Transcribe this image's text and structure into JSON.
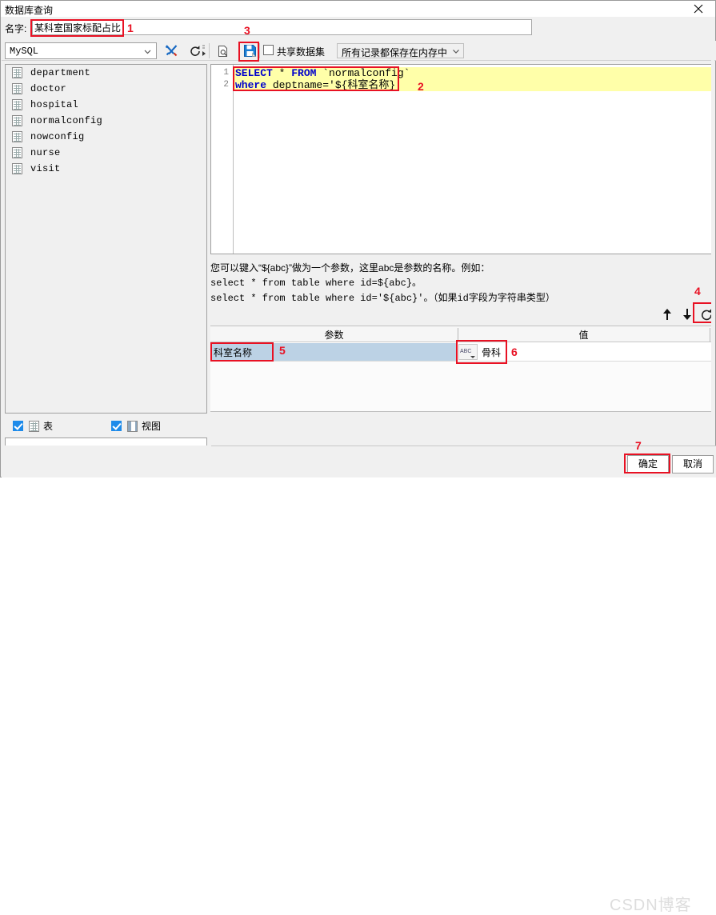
{
  "window": {
    "title": "数据库查询",
    "close_icon": "close-icon"
  },
  "name_row": {
    "label": "名字:",
    "value": "某科室国家标配占比",
    "placeholder": ""
  },
  "toolbar": {
    "db_type": "MySQL",
    "db_dropdown_icon": "chevron-down-icon",
    "tools_icon": "wrench-screwdriver-icon",
    "refresh_icon": "refresh-icon",
    "overflow_icon": "toolbar-overflow-icon",
    "preview_icon": "preview-document-icon",
    "save_icon": "save-dataset-icon",
    "share_checkbox_label": "共享数据集",
    "share_checked": false,
    "memory_mode": "所有记录都保存在内存中",
    "memory_dropdown_icon": "chevron-down-icon"
  },
  "tree": {
    "items": [
      {
        "label": "department",
        "icon": "table-icon"
      },
      {
        "label": "doctor",
        "icon": "table-icon"
      },
      {
        "label": "hospital",
        "icon": "table-icon"
      },
      {
        "label": "normalconfig",
        "icon": "table-icon"
      },
      {
        "label": "nowconfig",
        "icon": "table-icon"
      },
      {
        "label": "nurse",
        "icon": "table-icon"
      },
      {
        "label": "visit",
        "icon": "table-icon"
      }
    ]
  },
  "tree_filters": {
    "table": {
      "label": "表",
      "checked": true,
      "icon": "table-icon"
    },
    "view": {
      "label": "视图",
      "checked": true,
      "icon": "view-icon"
    }
  },
  "editor": {
    "line_numbers": [
      "1",
      "2"
    ],
    "lines": [
      {
        "tokens": [
          {
            "text": "SELECT",
            "type": "kw"
          },
          {
            "text": " * ",
            "type": "plain"
          },
          {
            "text": "FROM",
            "type": "kw"
          },
          {
            "text": " `normalconfig`",
            "type": "plain"
          }
        ]
      },
      {
        "tokens": [
          {
            "text": "where",
            "type": "kw"
          },
          {
            "text": " deptname='${科室名称}'",
            "type": "plain"
          }
        ]
      }
    ]
  },
  "help": {
    "line1": "您可以键入“${abc}”做为一个参数，这里abc是参数的名称。例如：",
    "line2": "select * from table where id=${abc}。",
    "line3": "select * from table where id='${abc}'。（如果id字段为字符串类型）"
  },
  "param_toolbar": {
    "move_up_icon": "arrow-up-icon",
    "move_down_icon": "arrow-down-icon",
    "refresh_icon": "refresh-params-icon"
  },
  "param_table": {
    "headers": [
      "参数",
      "值"
    ],
    "rows": [
      {
        "name": "科室名称",
        "value": "骨科",
        "value_type_icon": "abc-type-icon"
      }
    ]
  },
  "footer": {
    "ok_label": "确定",
    "cancel_label": "取消",
    "watermark": "CSDN博客"
  },
  "annotations": [
    {
      "number": "1"
    },
    {
      "number": "2"
    },
    {
      "number": "3"
    },
    {
      "number": "4"
    },
    {
      "number": "5"
    },
    {
      "number": "6"
    },
    {
      "number": "7"
    }
  ],
  "colors": {
    "annotation_red": "#e81123",
    "editor_highlight": "#ffffa9",
    "keyword_blue": "#0000cc",
    "selected_row": "#bcd2e5",
    "checkbox_blue": "#1e8bea"
  }
}
